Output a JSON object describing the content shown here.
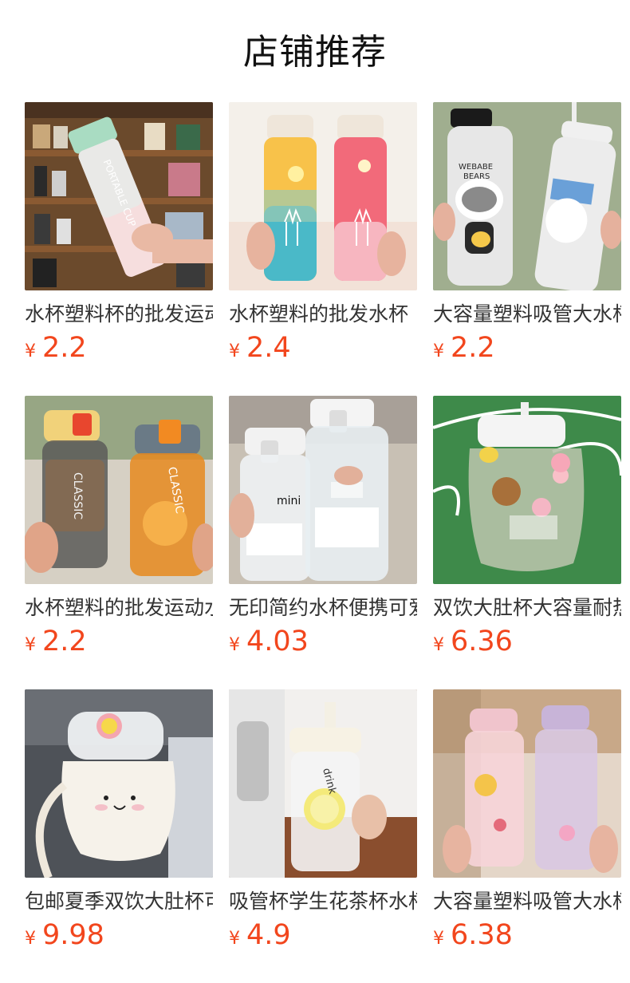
{
  "shop": {
    "title": "店铺推荐"
  },
  "products": [
    {
      "name": "水杯塑料杯的批发运动",
      "currency": "¥",
      "price": "2.2",
      "image": "frosted-portable-cup-photo"
    },
    {
      "name": "水杯塑料的批发水杯",
      "currency": "¥",
      "price": "2.4",
      "image": "gradient-deer-bottles-photo"
    },
    {
      "name": "大容量塑料吸管大水杯",
      "currency": "¥",
      "price": "2.2",
      "image": "we-bare-bears-bottles-photo"
    },
    {
      "name": "水杯塑料的批发运动水",
      "currency": "¥",
      "price": "2.2",
      "image": "classic-kids-bottles-photo"
    },
    {
      "name": "无印简约水杯便携可爱",
      "currency": "¥",
      "price": "4.03",
      "image": "mini-and-medium-cups-photo"
    },
    {
      "name": "双饮大肚杯大容量耐热",
      "currency": "¥",
      "price": "6.36",
      "image": "big-belly-sticker-bottle-photo"
    },
    {
      "name": "包邮夏季双饮大肚杯可",
      "currency": "¥",
      "price": "9.98",
      "image": "cute-face-bottle-photo"
    },
    {
      "name": "吸管杯学生花茶杯水杯",
      "currency": "¥",
      "price": "4.9",
      "image": "lemon-straw-bottle-photo"
    },
    {
      "name": "大容量塑料吸管大水杯",
      "currency": "¥",
      "price": "6.38",
      "image": "pink-purple-time-bottles-photo"
    }
  ]
}
